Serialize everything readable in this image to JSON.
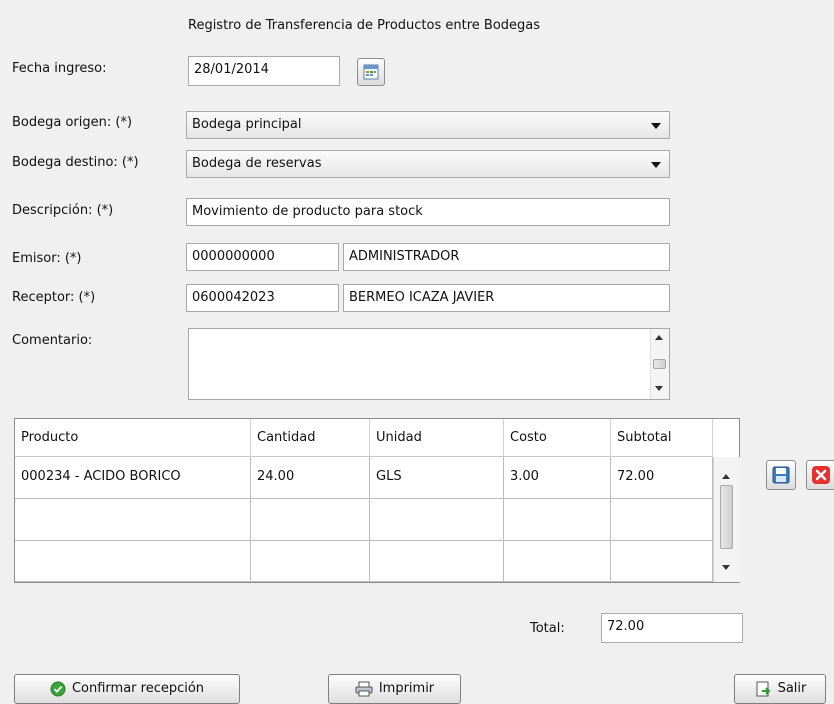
{
  "title": "Registro de Transferencia de Productos entre Bodegas",
  "form": {
    "fecha_label": "Fecha ingreso:",
    "fecha_value": "28/01/2014",
    "bodega_origen_label": "Bodega origen: (*)",
    "bodega_origen_value": "Bodega principal",
    "bodega_destino_label": "Bodega destino: (*)",
    "bodega_destino_value": "Bodega de reservas",
    "descripcion_label": "Descripción: (*)",
    "descripcion_value": "Movimiento de producto para stock",
    "emisor_label": "Emisor: (*)",
    "emisor_id": "0000000000",
    "emisor_name": "ADMINISTRADOR",
    "receptor_label": "Receptor: (*)",
    "receptor_id": "0600042023",
    "receptor_name": "BERMEO ICAZA JAVIER",
    "comentario_label": "Comentario:",
    "comentario_value": ""
  },
  "table": {
    "headers": [
      "Producto",
      "Cantidad",
      "Unidad",
      "Costo",
      "Subtotal"
    ],
    "rows": [
      [
        "000234 - ACIDO BORICO",
        "24.00",
        "GLS",
        "3.00",
        "72.00"
      ],
      [
        "",
        "",
        "",
        "",
        ""
      ],
      [
        "",
        "",
        "",
        "",
        ""
      ]
    ]
  },
  "total_label": "Total:",
  "total_value": "72.00",
  "buttons": {
    "confirmar": "Confirmar recepción",
    "imprimir": "Imprimir",
    "salir": "Salir"
  },
  "icons": {
    "calendar": "calendar-icon",
    "save": "save-icon",
    "delete": "delete-icon",
    "check": "check-circle-icon",
    "printer": "printer-icon",
    "exit": "exit-icon"
  },
  "colors": {
    "delete_red": "#e53030",
    "check_green": "#3aa53a",
    "save_blue": "#3b7bc4"
  }
}
